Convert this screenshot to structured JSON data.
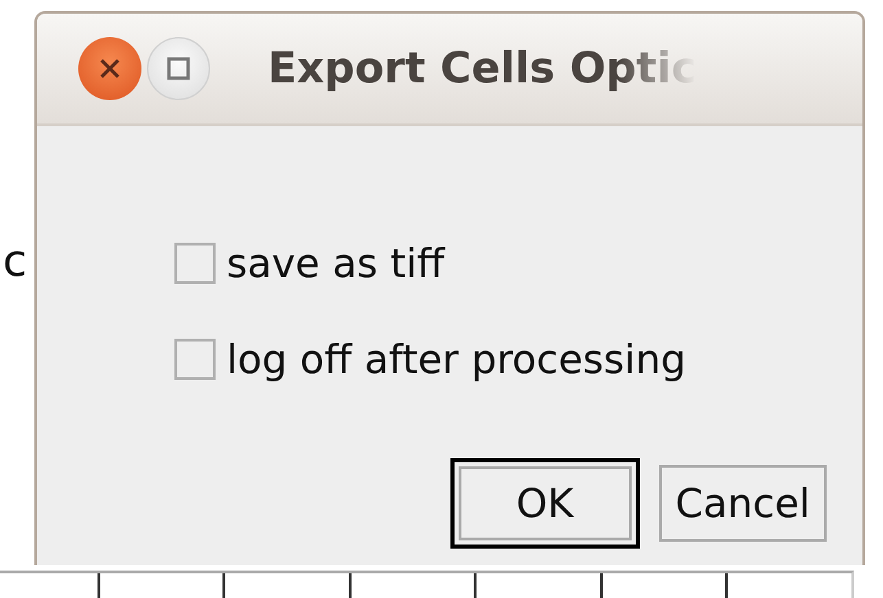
{
  "background_text": "c",
  "window": {
    "title": "Export Cells Optic"
  },
  "options": [
    {
      "label": "save as tiff",
      "checked": false
    },
    {
      "label": "log off after processing",
      "checked": false
    }
  ],
  "buttons": [
    {
      "label": "OK",
      "default": true
    },
    {
      "label": "Cancel",
      "default": false
    }
  ]
}
